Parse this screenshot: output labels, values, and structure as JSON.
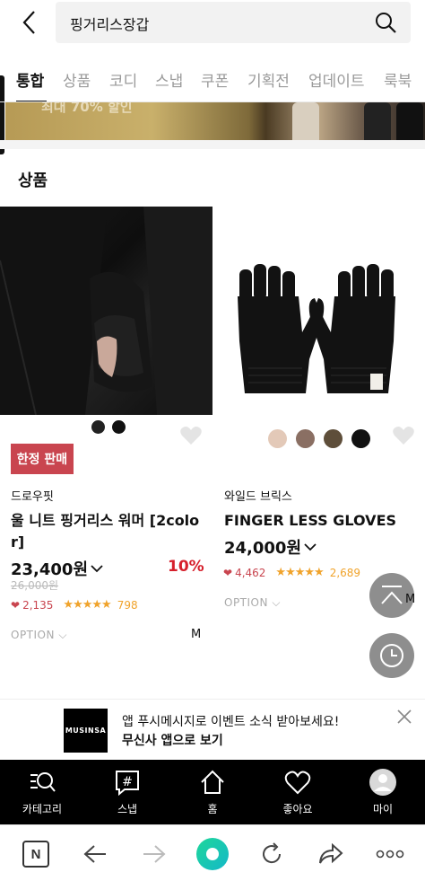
{
  "search": {
    "query": "핑거리스장갑"
  },
  "tabs": [
    {
      "label": "통합",
      "active": true
    },
    {
      "label": "상품"
    },
    {
      "label": "코디"
    },
    {
      "label": "스냅"
    },
    {
      "label": "쿠폰"
    },
    {
      "label": "기획전"
    },
    {
      "label": "업데이트"
    },
    {
      "label": "룩북"
    }
  ],
  "banner": {
    "text": "최대 70% 할인"
  },
  "section": {
    "title": "상품"
  },
  "products": [
    {
      "badge": "한정 판매",
      "brand": "드로우핏",
      "name_line1": "울 니트 핑거리스 워머 [2colo",
      "name_line2": "r]",
      "price": "23,400원",
      "discount": "10%",
      "original_price": "26,000원",
      "likes": "2,135",
      "rating_stars": "★★★★★",
      "reviews": "798",
      "option_label": "OPTION",
      "size": "M",
      "colors": [
        "#222222",
        "#111111"
      ]
    },
    {
      "brand": "와일드 브릭스",
      "name_line1": "FINGER LESS GLOVES",
      "price": "24,000원",
      "likes": "4,462",
      "rating_stars": "★★★★★",
      "reviews": "2,689",
      "option_label": "OPTION",
      "colors": [
        "#e3c9b8",
        "#8a6f63",
        "#5e4e3a",
        "#111111"
      ]
    }
  ],
  "floating": {
    "size_label": "M"
  },
  "promo": {
    "logo": "MUSINSA",
    "line1": "앱 푸시메시지로 이벤트 소식 받아보세요!",
    "line2": "무신사 앱으로 보기"
  },
  "bottom_nav": [
    {
      "label": "카테고리",
      "icon": "category-search-icon"
    },
    {
      "label": "스냅",
      "icon": "snap-hashtag-icon"
    },
    {
      "label": "홈",
      "icon": "home-icon"
    },
    {
      "label": "좋아요",
      "icon": "heart-icon"
    },
    {
      "label": "마이",
      "icon": "profile-icon"
    }
  ],
  "browser": {
    "n_label": "N"
  }
}
